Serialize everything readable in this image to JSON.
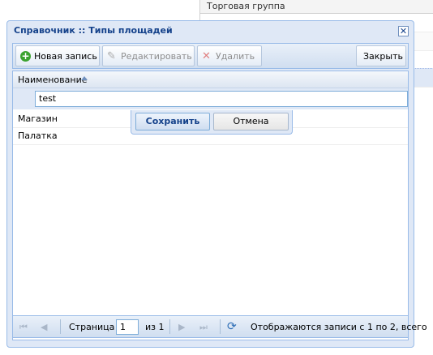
{
  "background": {
    "column_header": "Торговая группа"
  },
  "window": {
    "title": "Справочник :: Типы площадей",
    "close_symbol": "✕"
  },
  "toolbar": {
    "new_record": "Новая запись",
    "edit": "Редактировать",
    "delete": "Удалить",
    "close": "Закрыть"
  },
  "grid": {
    "column_header": "Наименование",
    "editor_value": "test",
    "rows": [
      "Магазин",
      "Палатка"
    ]
  },
  "row_editor": {
    "save": "Сохранить",
    "cancel": "Отмена"
  },
  "pager": {
    "page_label": "Страница",
    "page_value": "1",
    "of_label": "из 1",
    "status": "Отображаются записи с 1 по 2, всего"
  },
  "colors": {
    "title_text": "#15428b",
    "window_bg": "#dfe8f6",
    "border": "#99bbe8",
    "add_icon": "#3aa22f"
  },
  "icons": {
    "add": "add-circle-icon",
    "edit": "pencil-icon",
    "delete": "x-icon",
    "refresh": "refresh-icon",
    "first": "first-page-icon",
    "prev": "prev-page-icon",
    "next": "next-page-icon",
    "last": "last-page-icon"
  }
}
